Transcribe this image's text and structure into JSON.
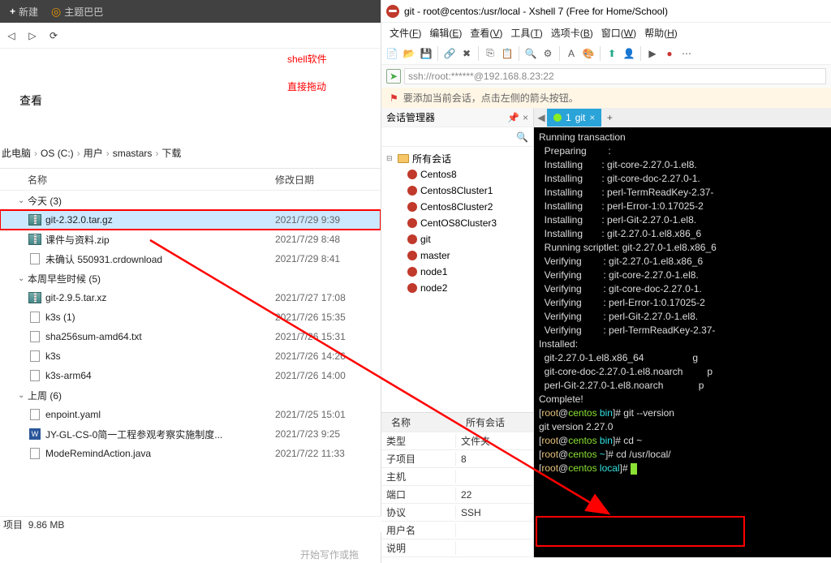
{
  "browser": {
    "new_tab": "新建",
    "theme": "主题巴巴"
  },
  "explorer": {
    "view_label": "查看",
    "breadcrumb": [
      "此电脑",
      "OS (C:)",
      "用户",
      "smastars",
      "下载"
    ],
    "columns": {
      "name": "名称",
      "date": "修改日期"
    },
    "groups": [
      {
        "title": "今天 (3)",
        "items": [
          {
            "name": "git-2.32.0.tar.gz",
            "date": "2021/7/29 9:39",
            "icon": "zip",
            "selected": true
          },
          {
            "name": "课件与资料.zip",
            "date": "2021/7/29 8:48",
            "icon": "zip"
          },
          {
            "name": "未确认 550931.crdownload",
            "date": "2021/7/29 8:41",
            "icon": "doc"
          }
        ]
      },
      {
        "title": "本周早些时候 (5)",
        "items": [
          {
            "name": "git-2.9.5.tar.xz",
            "date": "2021/7/27 17:08",
            "icon": "zip"
          },
          {
            "name": "k3s (1)",
            "date": "2021/7/26 15:35",
            "icon": "doc"
          },
          {
            "name": "sha256sum-amd64.txt",
            "date": "2021/7/26 15:31",
            "icon": "doc"
          },
          {
            "name": "k3s",
            "date": "2021/7/26 14:26",
            "icon": "doc"
          },
          {
            "name": "k3s-arm64",
            "date": "2021/7/26 14:00",
            "icon": "doc"
          }
        ]
      },
      {
        "title": "上周 (6)",
        "items": [
          {
            "name": "enpoint.yaml",
            "date": "2021/7/25 15:01",
            "icon": "doc"
          },
          {
            "name": "JY-GL-CS-0简一工程参观考察实施制度...",
            "date": "2021/7/23 9:25",
            "icon": "word"
          },
          {
            "name": "ModeRemindAction.java",
            "date": "2021/7/22 11:33",
            "icon": "doc"
          }
        ]
      }
    ],
    "status": {
      "items_label": "项目",
      "size": "9.86 MB"
    },
    "footer": "开始写作或拖"
  },
  "xshell": {
    "title": "git - root@centos:/usr/local - Xshell 7 (Free for Home/School)",
    "menu": [
      {
        "l": "文件",
        "k": "F"
      },
      {
        "l": "编辑",
        "k": "E"
      },
      {
        "l": "查看",
        "k": "V"
      },
      {
        "l": "工具",
        "k": "T"
      },
      {
        "l": "选项卡",
        "k": "B"
      },
      {
        "l": "窗口",
        "k": "W"
      },
      {
        "l": "帮助",
        "k": "H"
      }
    ],
    "address": "ssh://root:******@192.168.8.23:22",
    "hint": "要添加当前会话，点击左侧的箭头按钮。",
    "session_mgr": {
      "title": "会话管理器",
      "root": "所有会话",
      "items": [
        "Centos8",
        "Centos8Cluster1",
        "Centos8Cluster2",
        "CentOS8Cluster3",
        "git",
        "master",
        "node1",
        "node2"
      ],
      "props": [
        {
          "k": "名称",
          "v": "所有会话"
        },
        {
          "k": "类型",
          "v": "文件夹"
        },
        {
          "k": "子项目",
          "v": "8"
        },
        {
          "k": "主机",
          "v": ""
        },
        {
          "k": "端口",
          "v": "22"
        },
        {
          "k": "协议",
          "v": "SSH"
        },
        {
          "k": "用户名",
          "v": ""
        },
        {
          "k": "说明",
          "v": ""
        }
      ]
    },
    "tab": {
      "index": "1",
      "name": "git"
    },
    "terminal_lines": [
      {
        "t": "Running transaction"
      },
      {
        "t": "  Preparing        :"
      },
      {
        "t": "  Installing       : git-core-2.27.0-1.el8."
      },
      {
        "t": "  Installing       : git-core-doc-2.27.0-1."
      },
      {
        "t": "  Installing       : perl-TermReadKey-2.37-"
      },
      {
        "t": "  Installing       : perl-Error-1:0.17025-2"
      },
      {
        "t": "  Installing       : perl-Git-2.27.0-1.el8."
      },
      {
        "t": "  Installing       : git-2.27.0-1.el8.x86_6"
      },
      {
        "t": "  Running scriptlet: git-2.27.0-1.el8.x86_6"
      },
      {
        "t": "  Verifying        : git-2.27.0-1.el8.x86_6"
      },
      {
        "t": "  Verifying        : git-core-2.27.0-1.el8."
      },
      {
        "t": "  Verifying        : git-core-doc-2.27.0-1."
      },
      {
        "t": "  Verifying        : perl-Error-1:0.17025-2"
      },
      {
        "t": "  Verifying        : perl-Git-2.27.0-1.el8."
      },
      {
        "t": "  Verifying        : perl-TermReadKey-2.37-"
      },
      {
        "t": ""
      },
      {
        "t": "Installed:"
      },
      {
        "t": "  git-2.27.0-1.el8.x86_64                  g"
      },
      {
        "t": "  git-core-doc-2.27.0-1.el8.noarch         p"
      },
      {
        "t": "  perl-Git-2.27.0-1.el8.noarch             p"
      },
      {
        "t": ""
      },
      {
        "t": "Complete!"
      },
      {
        "p": "[root@centos bin]# ",
        "c": "git --version"
      },
      {
        "t": "git version 2.27.0"
      },
      {
        "p": "[root@centos bin]# ",
        "c": "cd ~"
      },
      {
        "p": "[root@centos ~]# ",
        "c": "cd /usr/local/"
      },
      {
        "p": "[root@centos local]# ",
        "cursor": true
      }
    ]
  },
  "annotation": {
    "line1": "shell软件",
    "line2": "直接拖动"
  }
}
